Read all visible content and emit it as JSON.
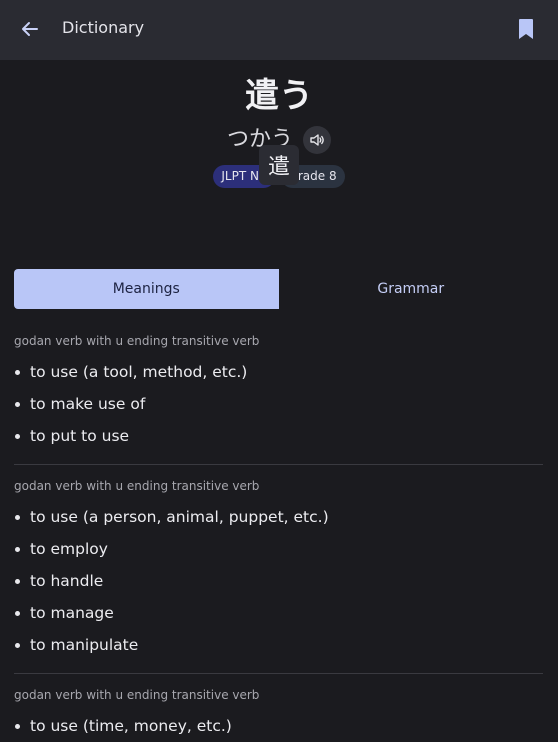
{
  "appbar": {
    "title": "Dictionary"
  },
  "entry": {
    "headword": "遣う",
    "reading": "つかう",
    "badges": [
      "JLPT N1",
      "Grade 8"
    ],
    "kanji": [
      "遣"
    ]
  },
  "tabs": [
    {
      "label": "Meanings",
      "active": true
    },
    {
      "label": "Grammar",
      "active": false
    }
  ],
  "senses": [
    {
      "pos": "godan verb with u ending  transitive verb",
      "glosses": [
        "to use (a tool, method, etc.)",
        "to make use of",
        "to put to use"
      ]
    },
    {
      "pos": "godan verb with u ending  transitive verb",
      "glosses": [
        "to use (a person, animal, puppet, etc.)",
        "to employ",
        "to handle",
        "to manage",
        "to manipulate"
      ]
    },
    {
      "pos": "godan verb with u ending  transitive verb",
      "glosses": [
        "to use (time, money, etc.)"
      ]
    }
  ],
  "colors": {
    "accent": "#b9c6f7",
    "background": "#1b1b1f",
    "appbar": "#2a2b32"
  },
  "icons": {
    "back": "arrow-left-icon",
    "bookmark": "bookmark-icon",
    "audio": "speaker-icon"
  }
}
